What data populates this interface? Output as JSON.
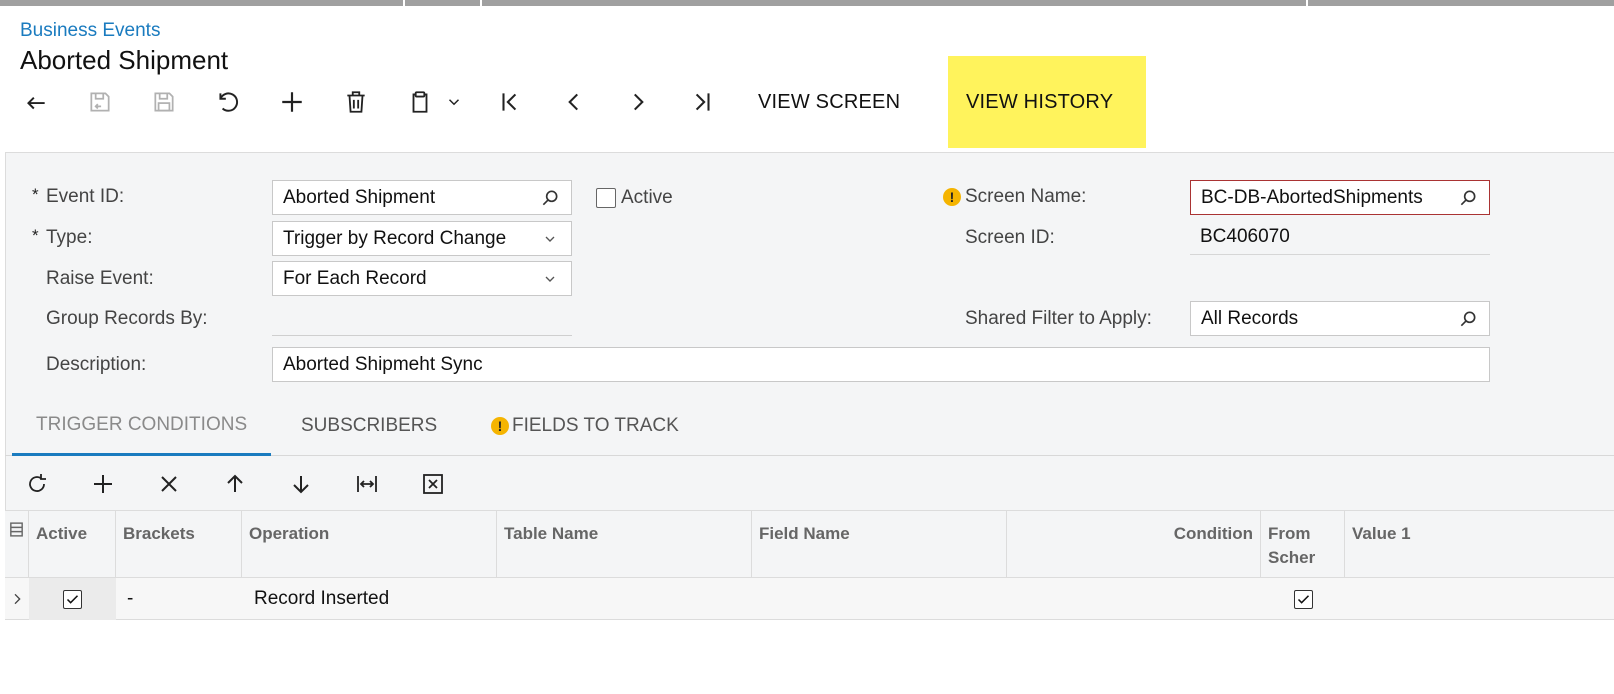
{
  "breadcrumb": "Business Events",
  "page_title": "Aborted Shipment",
  "toolbar": {
    "icons": [
      "back-icon",
      "save-and-close-icon",
      "save-icon",
      "undo-icon",
      "add-icon",
      "delete-icon",
      "copy-paste-icon",
      "chevron-down-icon",
      "first-record-icon",
      "previous-record-icon",
      "next-record-icon",
      "last-record-icon"
    ],
    "view_screen": "VIEW SCREEN",
    "view_history": "VIEW HISTORY",
    "highlight_color": "#fff35c"
  },
  "form": {
    "event_id": {
      "label": "Event ID:",
      "required": "*",
      "value": "Aborted Shipment"
    },
    "active": {
      "label": "Active",
      "checked": false
    },
    "type": {
      "label": "Type:",
      "required": "*",
      "value": "Trigger by Record Change"
    },
    "raise_event": {
      "label": "Raise Event:",
      "value": "For Each Record"
    },
    "group_records_by": {
      "label": "Group Records By:",
      "value": ""
    },
    "description": {
      "label": "Description:",
      "value": "Aborted Shipmeht Sync"
    },
    "screen_name": {
      "label": "Screen Name:",
      "warning": "!",
      "value": "BC-DB-AbortedShipments"
    },
    "screen_id": {
      "label": "Screen ID:",
      "value": "BC406070"
    },
    "shared_filter": {
      "label": "Shared Filter to Apply:",
      "value": "All Records"
    }
  },
  "tabs": [
    {
      "label": "TRIGGER CONDITIONS",
      "active": true
    },
    {
      "label": "SUBSCRIBERS",
      "active": false
    },
    {
      "label": "FIELDS TO TRACK",
      "active": false,
      "warning": "!"
    }
  ],
  "grid_toolbar": {
    "icons": [
      "refresh-icon",
      "add-row-icon",
      "delete-row-icon",
      "move-up-icon",
      "move-down-icon",
      "fit-columns-icon",
      "export-excel-icon"
    ]
  },
  "grid": {
    "columns": [
      "Active",
      "Brackets",
      "Operation",
      "Table Name",
      "Field Name",
      "Condition",
      "From Scher",
      "Value 1"
    ],
    "rows": [
      {
        "active": true,
        "brackets": "-",
        "operation": "Record Inserted",
        "table_name": "",
        "field_name": "",
        "condition": "",
        "from_schema": true,
        "value1": ""
      }
    ]
  },
  "colors": {
    "link": "#1a7bbf",
    "warning": "#f5b400",
    "error_border": "#a33333",
    "form_bg": "#f4f5f6"
  }
}
